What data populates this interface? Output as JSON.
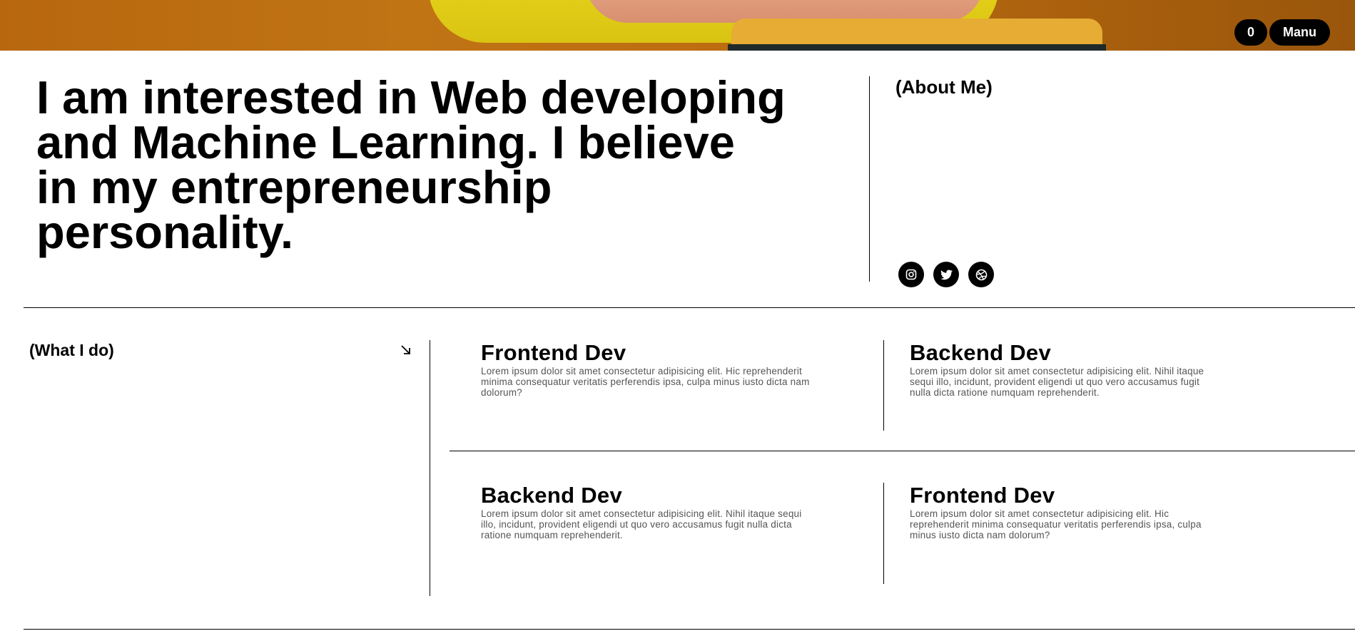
{
  "header": {
    "cart_count": "0",
    "menu_label": "Manu"
  },
  "intro": {
    "headline": "I am interested in Web developing and Machine Learning. I believe in my entrepreneurship personality.",
    "about_title": "(About Me)",
    "socials": [
      {
        "icon": "instagram-icon"
      },
      {
        "icon": "twitter-icon"
      },
      {
        "icon": "dribbble-icon"
      }
    ]
  },
  "services": {
    "title": "(What I do)",
    "arrow_icon": "arrow-down-right-icon",
    "cards": [
      {
        "title": "Frontend Dev",
        "text": "Lorem ipsum dolor sit amet consectetur adipisicing elit. Hic reprehenderit minima consequatur veritatis perferendis ipsa, culpa minus iusto dicta nam dolorum?"
      },
      {
        "title": "Backend Dev",
        "text": "Lorem ipsum dolor sit amet consectetur adipisicing elit. Nihil itaque sequi illo, incidunt, provident eligendi ut quo vero accusamus fugit nulla dicta ratione numquam reprehenderit."
      },
      {
        "title": "Backend Dev",
        "text": "Lorem ipsum dolor sit amet consectetur adipisicing elit. Nihil itaque sequi illo, incidunt, provident eligendi ut quo vero accusamus fugit nulla dicta ratione numquam reprehenderit."
      },
      {
        "title": "Frontend Dev",
        "text": "Lorem ipsum dolor sit amet consectetur adipisicing elit. Hic reprehenderit minima consequatur veritatis perferendis ipsa, culpa minus iusto dicta nam dolorum?"
      }
    ]
  }
}
